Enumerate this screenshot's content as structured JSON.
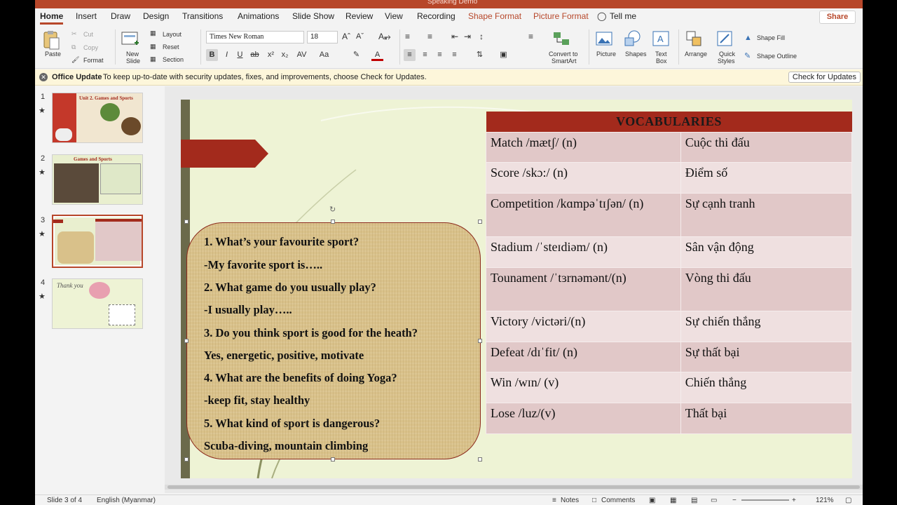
{
  "window": {
    "doc_title": "Speaking Demo"
  },
  "tabs": [
    {
      "label": "Home",
      "active": true
    },
    {
      "label": "Insert"
    },
    {
      "label": "Draw"
    },
    {
      "label": "Design"
    },
    {
      "label": "Transitions"
    },
    {
      "label": "Animations"
    },
    {
      "label": "Slide Show"
    },
    {
      "label": "Review"
    },
    {
      "label": "View"
    },
    {
      "label": "Recording"
    },
    {
      "label": "Shape Format",
      "contextual": true
    },
    {
      "label": "Picture Format",
      "contextual": true
    },
    {
      "label": "Tell me"
    }
  ],
  "share_label": "Share",
  "ribbon": {
    "paste": "Paste",
    "cut": "Cut",
    "copy": "Copy",
    "format": "Format",
    "new_slide_1": "New",
    "new_slide_2": "Slide",
    "layout": "Layout",
    "reset": "Reset",
    "section": "Section",
    "font_name": "Times New Roman",
    "font_size": "18",
    "convert_1": "Convert to",
    "convert_2": "SmartArt",
    "picture": "Picture",
    "shapes": "Shapes",
    "textbox_1": "Text",
    "textbox_2": "Box",
    "arrange": "Arrange",
    "quick_1": "Quick",
    "quick_2": "Styles",
    "shape_fill": "Shape Fill",
    "shape_outline": "Shape Outline"
  },
  "update_bar": {
    "title": "Office Update",
    "message": "To keep up-to-date with security updates, fixes, and improvements, choose Check for Updates.",
    "button": "Check for Updates"
  },
  "thumbnails": [
    {
      "num": "1",
      "title": "Unit 2. Games and Sports"
    },
    {
      "num": "2",
      "title": "Games and Sports"
    },
    {
      "num": "3",
      "title": ""
    },
    {
      "num": "4",
      "title": "Thank you"
    }
  ],
  "slide": {
    "vocab_header": "VOCABULARIES",
    "vocab_rows": [
      {
        "en": "Match /mætʃ/  (n)",
        "vi": "Cuộc thi đấu"
      },
      {
        "en": "Score /skɔ:/ (n)",
        "vi": "Điểm số"
      },
      {
        "en": "Competition /kɑmpəˈtɪʃən/ (n)",
        "vi": "Sự cạnh tranh"
      },
      {
        "en": "Stadium /ˈsteɪdiəm/  (n)",
        "vi": "Sân vận động"
      },
      {
        "en": "Tounament /ˈtɜrnəmənt/(n)",
        "vi": "Vòng thi đấu"
      },
      {
        "en": "Victory /victəri/(n)",
        "vi": "Sự chiến thắng"
      },
      {
        "en": "Defeat /dɪˈfit/  (n)",
        "vi": "Sự thất bại"
      },
      {
        "en": "Win /wɪn/ (v)",
        "vi": "Chiến thắng"
      },
      {
        "en": "Lose /luz/(v)",
        "vi": "Thất bại"
      }
    ],
    "qa_lines": [
      "1. What’s your favourite sport?",
      "-My favorite sport is…..",
      "2. What game do you usually play?",
      "-I usually play…..",
      "3. Do you think sport is good for the heath?",
      "Yes, energetic, positive, motivate",
      "4. What are the benefits of doing Yoga?",
      "-keep fit, stay healthy",
      "5. What kind of sport is dangerous?",
      "Scuba-diving, mountain climbing"
    ]
  },
  "status": {
    "slide_info": "Slide 3 of 4",
    "language": "English (Myanmar)",
    "notes": "Notes",
    "comments": "Comments",
    "zoom": "121%"
  },
  "colors": {
    "accent": "#b7472a",
    "table_header": "#a32a1c",
    "card": "#d9c18a"
  }
}
